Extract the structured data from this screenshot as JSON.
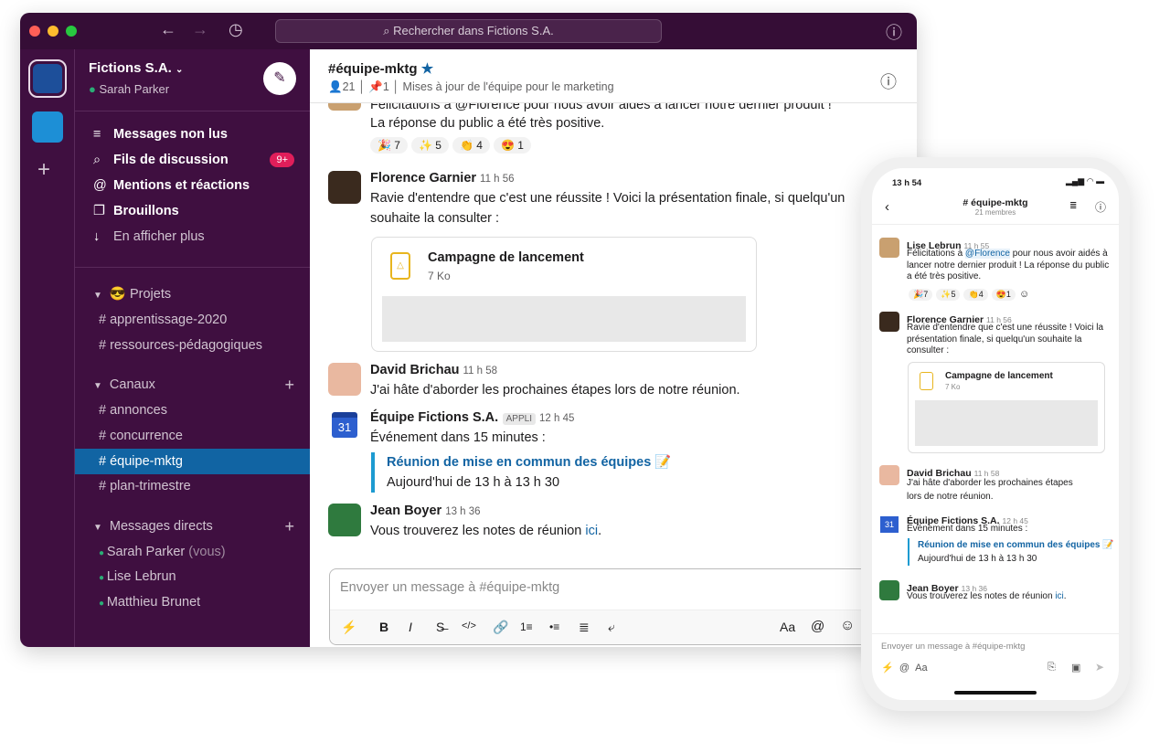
{
  "titlebar": {
    "search_placeholder": "Rechercher dans Fictions S.A.",
    "nav": [
      "back-arrow-icon",
      "forward-arrow-icon",
      "history-icon",
      "help-icon"
    ]
  },
  "workspace": {
    "name": "Fictions S.A.",
    "user": "Sarah Parker"
  },
  "sidebar": {
    "nav": [
      {
        "label": "Messages non lus",
        "icon": "≡"
      },
      {
        "label": "Fils de discussion",
        "icon": "⌕",
        "badge": "9+"
      },
      {
        "label": "Mentions et réactions",
        "icon": "@"
      },
      {
        "label": "Brouillons",
        "icon": "❐"
      },
      {
        "label": "En afficher plus",
        "icon": "↓"
      }
    ],
    "projects": {
      "title": "😎 Projets",
      "channels": [
        "apprentissage-2020",
        "ressources-pédagogiques"
      ]
    },
    "channels": {
      "title": "Canaux",
      "items": [
        "annonces",
        "concurrence",
        "équipe-mktg",
        "plan-trimestre"
      ],
      "selected": "équipe-mktg"
    },
    "dms": {
      "title": "Messages directs",
      "items": [
        {
          "name": "Sarah Parker",
          "suffix": "(vous)"
        },
        {
          "name": "Lise Lebrun"
        },
        {
          "name": "Matthieu Brunet"
        }
      ]
    }
  },
  "channel": {
    "name": "#équipe-mktg",
    "members": "21",
    "pins": "1",
    "topic": "Mises à jour de l'équipe pour le marketing"
  },
  "messages": {
    "lise": {
      "partial": "Félicitations à @Florence pour nous avoir aidés à lancer notre dernier produit !",
      "line2": "La réponse du public a été très positive.",
      "reactions": [
        {
          "emoji": "🎉",
          "count": "7"
        },
        {
          "emoji": "✨",
          "count": "5"
        },
        {
          "emoji": "👏",
          "count": "4"
        },
        {
          "emoji": "😍",
          "count": "1"
        }
      ]
    },
    "florence": {
      "author": "Florence Garnier",
      "time": "11 h 56",
      "text": "Ravie d'entendre que c'est une réussite ! Voici la présentation finale, si quelqu'un souhaite la consulter :",
      "file": {
        "name": "Campagne de lancement",
        "size": "7 Ko"
      }
    },
    "david": {
      "author": "David Brichau",
      "time": "11 h 58",
      "text": "J'ai hâte d'aborder les prochaines étapes lors de notre réunion."
    },
    "app": {
      "author": "Équipe Fictions S.A.",
      "badge": "APPLI",
      "time": "12 h 45",
      "text": "Événement dans 15 minutes :",
      "event_title": "Réunion de mise en commun des équipes",
      "event_emoji": "📝",
      "event_time": "Aujourd'hui de 13 h à 13 h 30",
      "cal_day": "31"
    },
    "jean": {
      "author": "Jean Boyer",
      "time": "13 h 36",
      "text": "Vous trouverez les notes de réunion ",
      "link": "ici",
      "end": "."
    }
  },
  "composer": {
    "placeholder": "Envoyer un message à #équipe-mktg",
    "tools": [
      "⚡",
      "B",
      "I",
      "S̶",
      "</>",
      "🔗",
      "1≡",
      "•≡",
      "≣",
      "⤶"
    ],
    "right": [
      "Aa",
      "@",
      "☺"
    ]
  },
  "phone": {
    "time": "13 h 54",
    "channel": "# équipe-mktg",
    "members": "21 membres",
    "lise": {
      "author": "Lise Lebrun",
      "time": "11 h 55",
      "pre": "Félicitations à ",
      "mention": "@Florence",
      "post": " pour nous avoir aidés à lancer notre dernier produit ! La réponse du public a été très positive."
    },
    "composer_placeholder": "Envoyer un message à #équipe-mktg",
    "composer_aa": "Aa"
  },
  "colors": {
    "aubergine": "#3f0f40",
    "titlebar": "#350d36",
    "selected": "#1164a3",
    "link": "#1264a3",
    "badge": "#e01e5a",
    "online": "#2bac76"
  }
}
